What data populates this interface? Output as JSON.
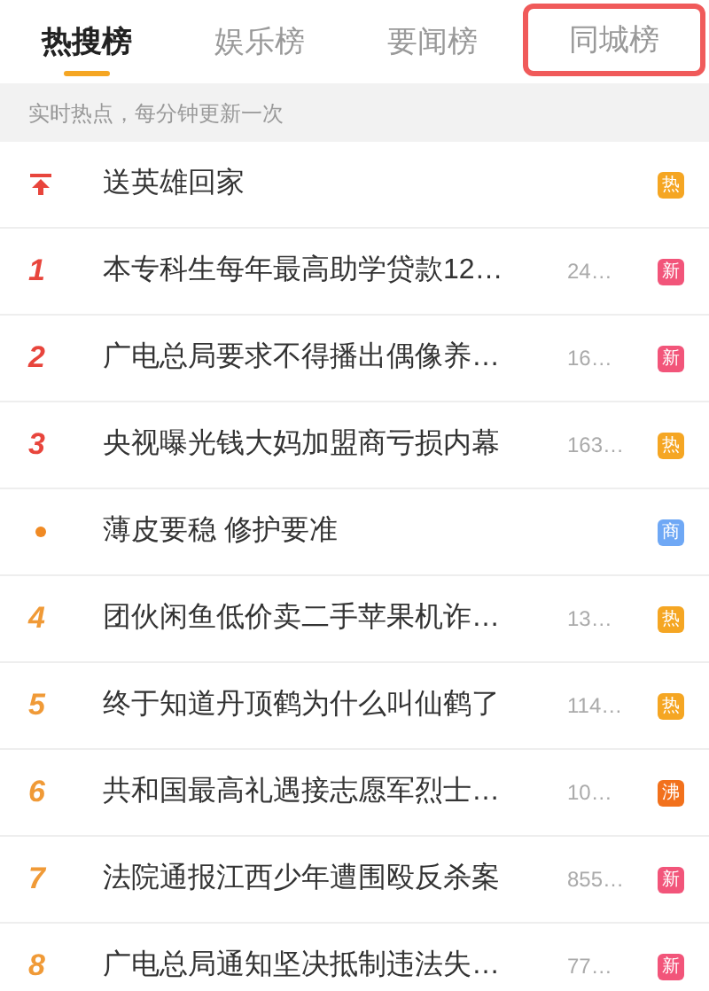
{
  "tabs": [
    {
      "label": "热搜榜",
      "selected": true,
      "highlighted": false
    },
    {
      "label": "娱乐榜",
      "selected": false,
      "highlighted": false
    },
    {
      "label": "要闻榜",
      "selected": false,
      "highlighted": false
    },
    {
      "label": "同城榜",
      "selected": false,
      "highlighted": true
    }
  ],
  "notice": "实时热点，每分钟更新一次",
  "items": [
    {
      "kind": "pin",
      "title": "送英雄回家",
      "badge": "热",
      "color": "#f5a623"
    },
    {
      "kind": "number",
      "rank": "1",
      "title": "本专科生每年最高助学贷款12…",
      "count": "24…",
      "badge": "新",
      "color": "#f2557a"
    },
    {
      "kind": "number",
      "rank": "2",
      "title": "广电总局要求不得播出偶像养…",
      "count": "16…",
      "badge": "新",
      "color": "#f2557a"
    },
    {
      "kind": "number",
      "rank": "3",
      "title": "央视曝光钱大妈加盟商亏损内幕",
      "count": "163…",
      "badge": "热",
      "color": "#f5a623"
    },
    {
      "kind": "dot",
      "title": "薄皮要稳 修护要准",
      "badge": "商",
      "color": "#6fa8f5"
    },
    {
      "kind": "number",
      "rank": "4",
      "title": "团伙闲鱼低价卖二手苹果机诈…",
      "count": "13…",
      "badge": "热",
      "color": "#f5a623"
    },
    {
      "kind": "number",
      "rank": "5",
      "title": "终于知道丹顶鹤为什么叫仙鹤了",
      "count": "114…",
      "badge": "热",
      "color": "#f5a623"
    },
    {
      "kind": "number",
      "rank": "6",
      "title": "共和国最高礼遇接志愿军烈士…",
      "count": "10…",
      "badge": "沸",
      "color": "#f2711c"
    },
    {
      "kind": "number",
      "rank": "7",
      "title": "法院通报江西少年遭围殴反杀案",
      "count": "855…",
      "badge": "新",
      "color": "#f2557a"
    },
    {
      "kind": "number",
      "rank": "8",
      "title": "广电总局通知坚决抵制违法失…",
      "count": "77…",
      "badge": "新",
      "color": "#f2557a"
    }
  ]
}
